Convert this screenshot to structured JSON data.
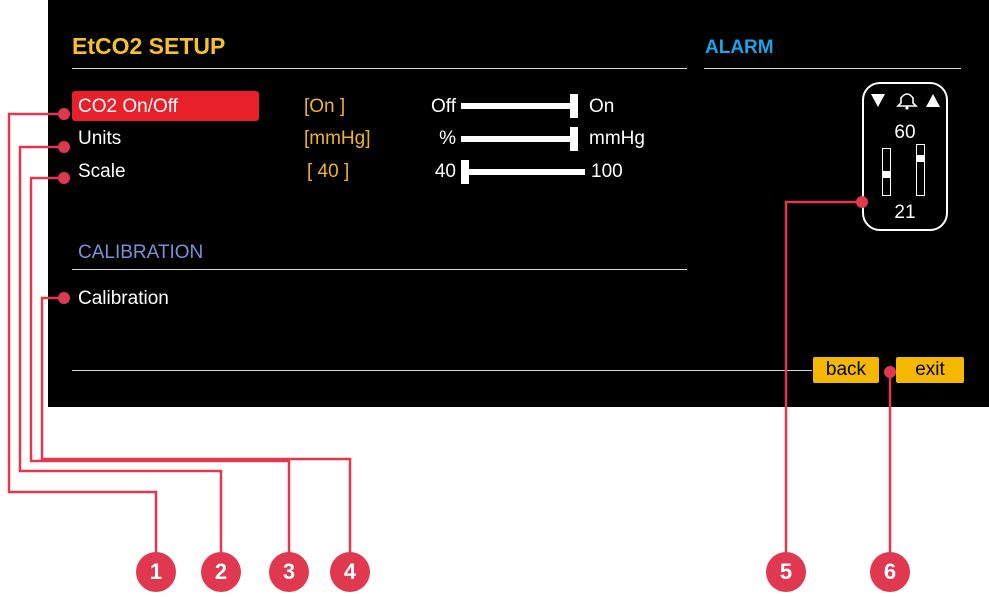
{
  "header": {
    "title": "EtCO2 SETUP",
    "alarm_title": "ALARM"
  },
  "settings": {
    "co2": {
      "label": "CO2  On/Off",
      "value": "[On      ]",
      "min_label": "Off",
      "max_label": "On",
      "position": 1.0
    },
    "units": {
      "label": "Units",
      "value": "[mmHg]",
      "min_label": "%",
      "max_label": "mmHg",
      "position": 1.0
    },
    "scale": {
      "label": "Scale",
      "value": "[ 40     ]",
      "min_label": "40",
      "max_label": "100",
      "position": 0.0
    }
  },
  "calibration": {
    "section_title": "CALIBRATION",
    "item_label": "Calibration"
  },
  "alarm": {
    "upper": "60",
    "lower": "21",
    "down_icon": "triangle-down",
    "bell_icon": "bell",
    "up_icon": "triangle-up"
  },
  "buttons": {
    "back": "back",
    "exit": "exit"
  },
  "callouts": [
    "1",
    "2",
    "3",
    "4",
    "5",
    "6"
  ],
  "colors": {
    "accent_yellow": "#f6c12b",
    "alarm_blue": "#1aa3e8",
    "highlight_red": "#e8202a",
    "callout": "#e0384f"
  }
}
